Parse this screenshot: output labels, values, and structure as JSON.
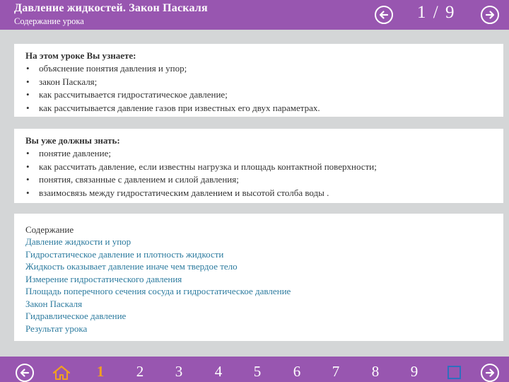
{
  "header": {
    "title": "Давление жидкостей. Закон Паскаля",
    "subtitle": "Содержание урока",
    "pager": "1 / 9",
    "prev_icon": "arrow-left-circle-icon",
    "next_icon": "arrow-right-circle-icon"
  },
  "learn": {
    "heading": "На этом уроке Вы узнаете:",
    "items": [
      "объяснение понятия давления и упор;",
      "закон Паскаля;",
      "как рассчитывается гидростатическое давление;",
      "как рассчитывается давление газов при известных его двух параметрах."
    ]
  },
  "know": {
    "heading": "Вы уже должны знать:",
    "items": [
      "понятие давление;",
      "как рассчитать давление, если известны нагрузка и площадь контактной поверхности;",
      "понятия, связанные с давлением и силой давления;",
      "взаимосвязь между гидростатическим давлением и высотой столба воды ."
    ]
  },
  "contents": {
    "heading": "Содержание",
    "links": [
      "Давление жидкости и упор",
      "Гидростатическое давление и плотность жидкости",
      "Жидкость оказывает давление иначе чем твердое тело",
      "Измерение гидростатического давления",
      "Площадь поперечного сечения сосуда и гидростатическое давление",
      "Закон Паскаля",
      "Гидравлическое давление",
      "Результат урока"
    ]
  },
  "footer": {
    "home_icon": "home-icon",
    "pages": [
      "1",
      "2",
      "3",
      "4",
      "5",
      "6",
      "7",
      "8",
      "9"
    ],
    "active_page": "1",
    "square_icon": "square-icon",
    "colors": {
      "bar": "#9856b0",
      "active": "#f0a020",
      "link": "#2b7a9e",
      "square": "#2e6fbe"
    }
  }
}
